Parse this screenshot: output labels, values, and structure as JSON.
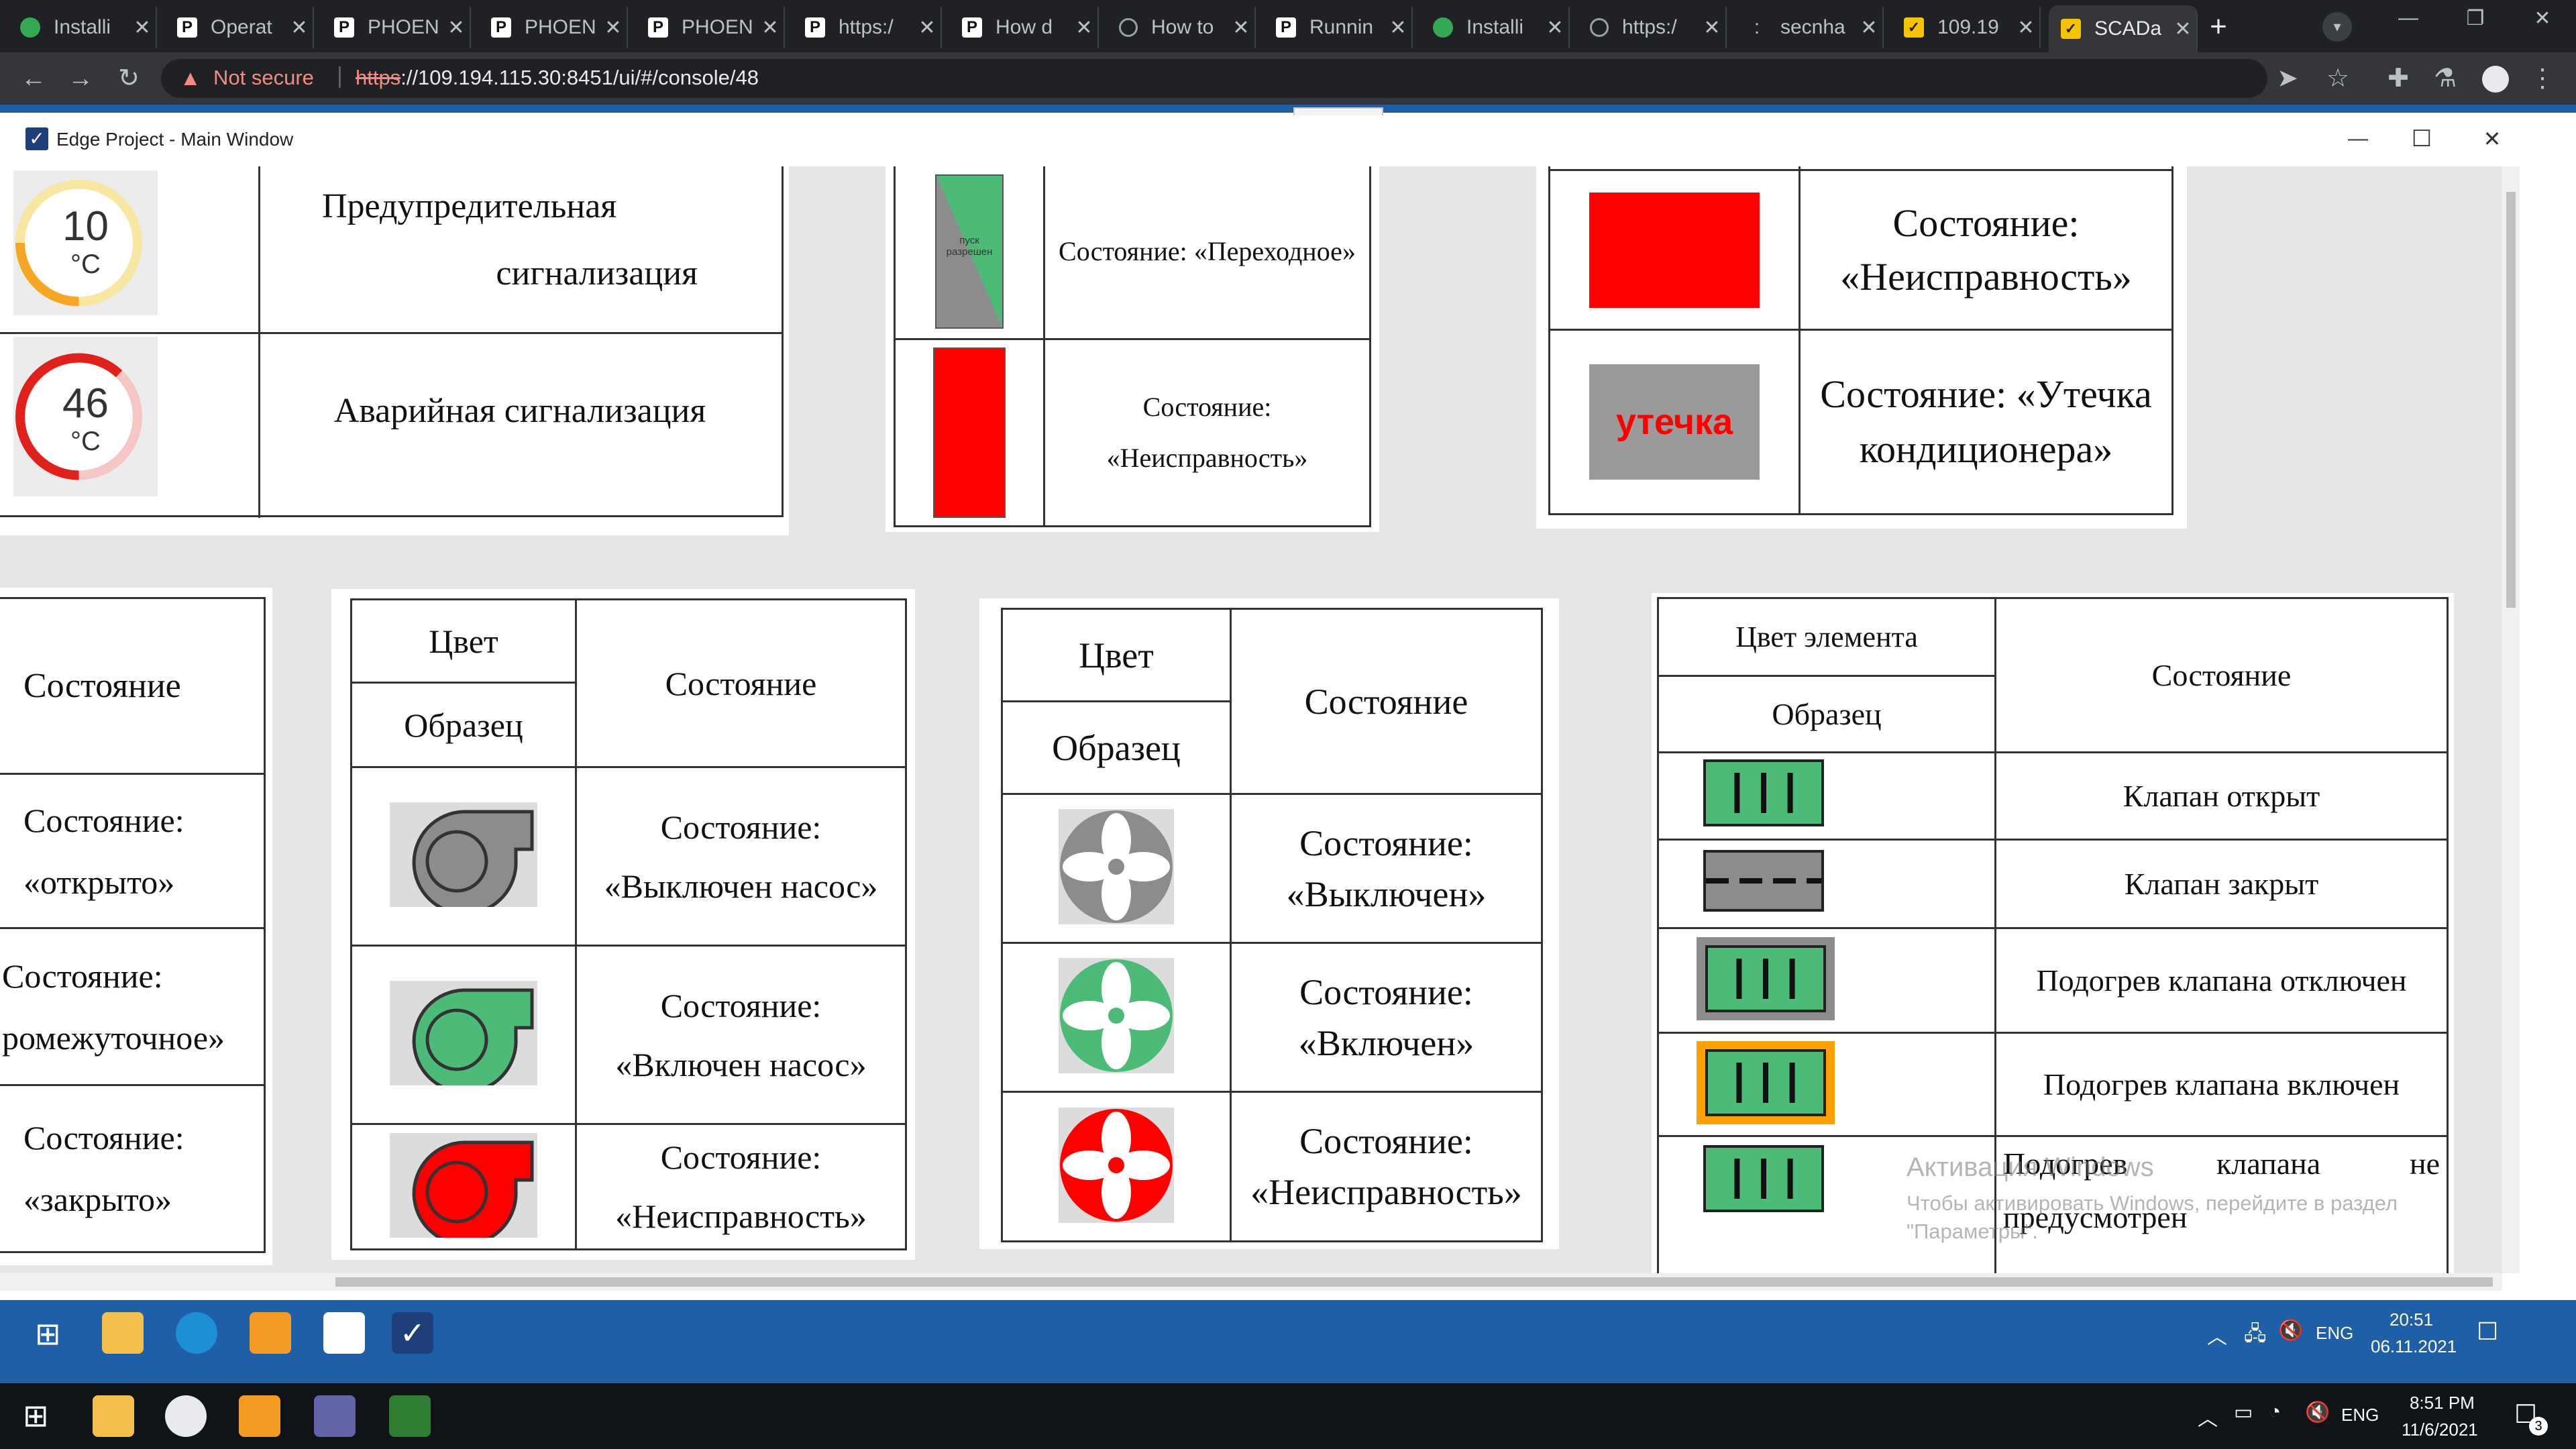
{
  "browser": {
    "tabs": [
      {
        "title": "Installi",
        "icon": "puzzle-icon"
      },
      {
        "title": "Operat",
        "icon": "phoenix-icon"
      },
      {
        "title": "PHOEN",
        "icon": "phoenix-icon"
      },
      {
        "title": "PHOEN",
        "icon": "phoenix-icon"
      },
      {
        "title": "PHOEN",
        "icon": "phoenix-icon"
      },
      {
        "title": "https:/",
        "icon": "phoenix-icon"
      },
      {
        "title": "How d",
        "icon": "phoenix-icon"
      },
      {
        "title": "How to",
        "icon": "globe-icon"
      },
      {
        "title": "Runnin",
        "icon": "phoenix-icon"
      },
      {
        "title": "Installi",
        "icon": "puzzle-icon"
      },
      {
        "title": "https:/",
        "icon": "globe-icon"
      },
      {
        "title": "secnha",
        "icon": "lock-icon"
      },
      {
        "title": "109.19",
        "icon": "scada-icon"
      },
      {
        "title": "SCADa",
        "icon": "scada-icon"
      }
    ],
    "new_tab": "+",
    "security_label": "Not secure",
    "url_scheme": "https",
    "url_rest": "://109.194.115.30:8451/ui/#/console/48"
  },
  "window": {
    "title": "Edge Project - Main Window",
    "minimize": "—",
    "maximize": "☐",
    "close": "✕"
  },
  "gauges": [
    {
      "value": "10",
      "unit": "°C",
      "fill": 0.25,
      "color": "#f5a623",
      "track": "#f7e7a3"
    },
    {
      "value": "46",
      "unit": "°C",
      "fill": 0.62,
      "color": "#e0201b",
      "track": "#f4c6c4"
    }
  ],
  "panel_alarm": {
    "row1": "Предупредительная сигнализация",
    "row2": "Аварийная сигнализация"
  },
  "panel_valve_state": {
    "swatch_text": "пуск разрешен",
    "row1": "Состояние: «Переходное»",
    "row2": "Состояние: «Неисправность»"
  },
  "panel_fault": {
    "row1": "Состояние: «Неисправность»",
    "leak_label": "утечка",
    "row2": "Состояние: «Утечка кондиционера»"
  },
  "panel_states": {
    "header": "Состояние",
    "rows": [
      "Состояние: «открыто»",
      "Состояние: ромежуточное»",
      "Состояние: «закрыто»"
    ]
  },
  "panel_pump": {
    "h_color": "Цвет",
    "h_sample": "Образец",
    "h_state": "Состояние",
    "rows": [
      {
        "color": "#8c8c8c",
        "state": "Состояние: «Выключен насос»"
      },
      {
        "color": "#4dbb78",
        "state": "Состояние: «Включен насос»"
      },
      {
        "color": "#ff0000",
        "state": "Состояние: «Неисправность»"
      }
    ]
  },
  "panel_fan": {
    "h_color": "Цвет",
    "h_sample": "Образец",
    "h_state": "Состояние",
    "rows": [
      {
        "color": "#8c8c8c",
        "state": "Состояние: «Выключен»"
      },
      {
        "color": "#4dbb78",
        "state": "Состояние: «Включен»"
      },
      {
        "color": "#ff0000",
        "state": "Состояние: «Неисправность»"
      }
    ]
  },
  "panel_valve": {
    "h_color": "Цвет элемента",
    "h_sample": "Образец",
    "h_state": "Состояние",
    "rows": [
      {
        "state": "Клапан открыт"
      },
      {
        "state": "Клапан закрыт"
      },
      {
        "state": "Подогрев клапана отключен"
      },
      {
        "state": "Подогрев клапана включен"
      },
      {
        "state": "Подогрев клапана не предусмотрен"
      }
    ]
  },
  "watermark": {
    "line1": "Активация Windows",
    "line2": "Чтобы активировать Windows, перейдите в раздел",
    "line3": "\"Параметры\"."
  },
  "taskbar_inner": {
    "lang": "ENG",
    "time": "20:51",
    "date": "06.11.2021"
  },
  "taskbar_outer": {
    "lang": "ENG",
    "time": "8:51 PM",
    "date": "11/6/2021",
    "notifications": "3"
  },
  "colors": {
    "green": "#4dbb78",
    "red": "#ff0000",
    "gray": "#8c8c8c",
    "orange": "#ff9f00",
    "taskbar_blue": "#1f5fa8"
  }
}
